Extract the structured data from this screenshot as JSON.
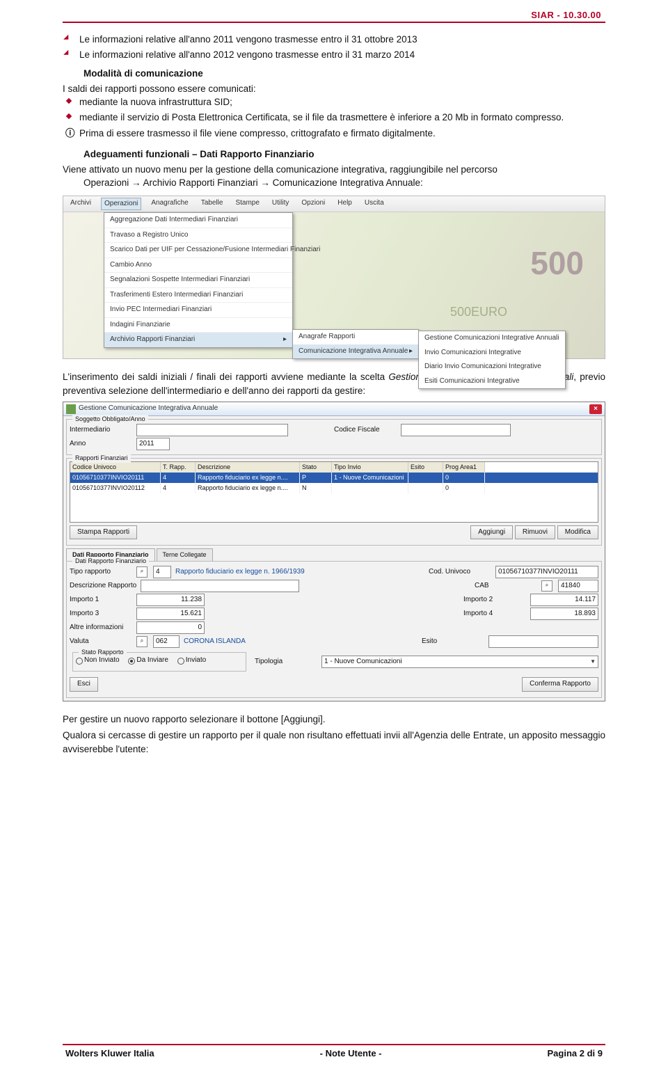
{
  "header_code": "SIAR - 10.30.00",
  "arrow_items": [
    "Le informazioni relative all'anno 2011 vengono trasmesse entro il 31 ottobre 2013",
    "Le informazioni relative all'anno 2012 vengono trasmesse entro il 31 marzo 2014"
  ],
  "modalita_head": "Modalità di comunicazione",
  "intro_line": "I saldi dei rapporti possono essere comunicati:",
  "diamond_items": [
    "mediante la nuova infrastruttura SID;",
    "mediante il servizio di Posta Elettronica Certificata, se il file da trasmettere è inferiore a 20 Mb in formato compresso."
  ],
  "info_line": "Prima di essere trasmesso il file viene compresso, crittografato e firmato digitalmente.",
  "adeguamenti_head": "Adeguamenti funzionali – Dati Rapporto Finanziario",
  "adeguamenti_p1": "Viene attivato un nuovo menu per la gestione della comunicazione integrativa, raggiungibile nel percorso",
  "adeguamenti_p2": "Operazioni → Archivio Rapporti Finanziari → Comunicazione Integrativa Annuale:",
  "menu": {
    "items": [
      "Archivi",
      "Operazioni",
      "Anagrafiche",
      "Tabelle",
      "Stampe",
      "Utility",
      "Opzioni",
      "Help",
      "Uscita"
    ],
    "dropdown": [
      "Aggregazione Dati Intermediari Finanziari",
      "Travaso a Registro Unico",
      "Scarico Dati per UIF per Cessazione/Fusione Intermediari Finanziari",
      "Cambio Anno",
      "Segnalazioni Sospette Intermediari Finanziari",
      "Trasferimenti Estero Intermediari Finanziari",
      "Invio PEC Intermediari Finanziari",
      "Indagini Finanziarie",
      "Archivio Rapporti Finanziari"
    ],
    "sub1": [
      "Anagrafe Rapporti",
      "Comunicazione Integrativa Annuale"
    ],
    "sub2": [
      "Gestione Comunicazioni Integrative Annuali",
      "Invio Comunicazioni Integrative",
      "Diario Invio Comunicazioni Integrative",
      "Esiti Comunicazioni Integrative"
    ],
    "euro500": "500",
    "euro_label": "500EURO"
  },
  "after_shot1_a": "L'inserimento dei saldi iniziali / finali dei rapporti avviene mediante la scelta ",
  "after_shot1_b": "Gestione Comunicazioni Integrative Annuali",
  "after_shot1_c": ", previo preventiva selezione dell'intermediario e dell'anno dei rapporti da gestire:",
  "dialog": {
    "title": "Gestione Comunicazione Integrativa Annuale",
    "section_top": "Soggetto Obbligato/Anno",
    "lbl_intermediario": "Intermediario",
    "lbl_codfiscale": "Codice Fiscale",
    "lbl_anno": "Anno",
    "anno_value": "2011",
    "group_rapp": "Rapporti Finanziari",
    "cols": [
      "Codice Univoco",
      "T. Rapp.",
      "Descrizione",
      "Stato",
      "Tipo Invio",
      "Esito",
      "Prog Area1"
    ],
    "row1": [
      "01056710377INVIO20111",
      "4",
      "Rapporto fiduciario ex legge n....",
      "P",
      "1 - Nuove Comunicazioni",
      "",
      "0"
    ],
    "row2": [
      "01056710377INVIO20112",
      "4",
      "Rapporto fiduciario ex legge n....",
      "N",
      "",
      "",
      "0"
    ],
    "btn_stampa": "Stampa Rapporti",
    "btn_aggiungi": "Aggiungi",
    "btn_rimuovi": "Rimuovi",
    "btn_modifica": "Modifica",
    "tab_active": "Dati Rapporto Finanziario",
    "tab_other": "Terne Collegate",
    "group_dati": "Dati Rapporto Finanziario",
    "lbl_tipo": "Tipo rapporto",
    "tipo_val": "4",
    "tipo_desc": "Rapporto fiduciario ex legge n. 1966/1939",
    "lbl_coduniv": "Cod. Univoco",
    "coduniv_val": "01056710377INVIO20111",
    "lbl_descr": "Descrizione Rapporto",
    "lbl_cab": "CAB",
    "cab_val": "41840",
    "lbl_imp1": "Importo 1",
    "imp1": "11.238",
    "lbl_imp2": "Importo 2",
    "imp2": "14.117",
    "lbl_imp3": "Importo 3",
    "imp3": "15.621",
    "lbl_imp4": "Importo 4",
    "imp4": "18.893",
    "lbl_altre": "Altre informazioni",
    "altre": "0",
    "lbl_valuta": "Valuta",
    "valuta_code": "062",
    "valuta_desc": "CORONA ISLANDA",
    "lbl_esito": "Esito",
    "group_stato": "Stato Rapporto",
    "r_noninv": "Non Inviato",
    "r_dainv": "Da Inviare",
    "r_inv": "Inviato",
    "lbl_tipologia": "Tipologia",
    "tipologia_val": "1 - Nuove Comunicazioni",
    "btn_esci": "Esci",
    "btn_conf": "Conferma Rapporto"
  },
  "closing_p1": "Per gestire un nuovo rapporto selezionare il bottone [Aggiungi].",
  "closing_p2": "Qualora si cercasse di gestire un rapporto per il quale non risultano effettuati invii all'Agenzia delle Entrate, un apposito messaggio avviserebbe l'utente:",
  "footer": {
    "left": "Wolters Kluwer Italia",
    "center": "- Note Utente -",
    "right": "Pagina 2 di 9"
  }
}
